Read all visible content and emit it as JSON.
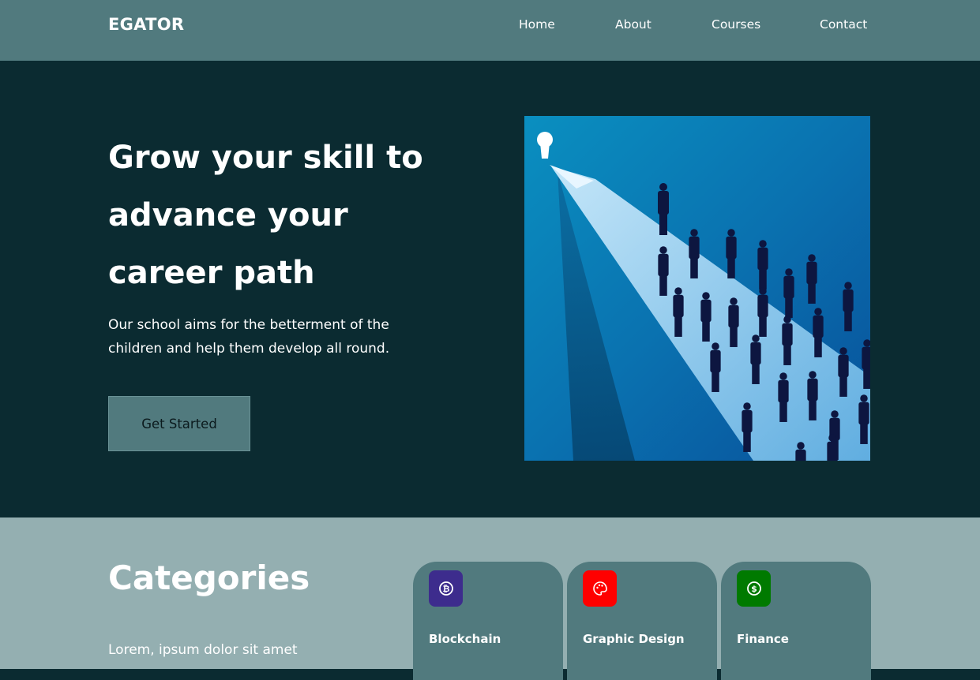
{
  "navbar": {
    "brand": "EGATOR",
    "links": [
      "Home",
      "About",
      "Courses",
      "Contact"
    ]
  },
  "hero": {
    "title": "Grow your skill to advance your career path",
    "description": "Our school aims for the betterment of the children and help them develop all round.",
    "cta_label": "Get Started",
    "image_icon": "career-arrow-illustration"
  },
  "categories": {
    "title": "Categories",
    "description": "Lorem, ipsum dolor sit amet",
    "cards": [
      {
        "label": "Blockchain",
        "icon": "bitcoin-icon",
        "color": "#3d2c8d"
      },
      {
        "label": "Graphic Design",
        "icon": "palette-icon",
        "color": "#ff0000"
      },
      {
        "label": "Finance",
        "icon": "dollar-icon",
        "color": "#007a00"
      }
    ]
  },
  "colors": {
    "navbar": "#517a7e",
    "hero_bg": "#0b2b31",
    "categories_bg": "#94afb1",
    "card_bg": "#517a7e",
    "button_bg": "#517a7e"
  }
}
